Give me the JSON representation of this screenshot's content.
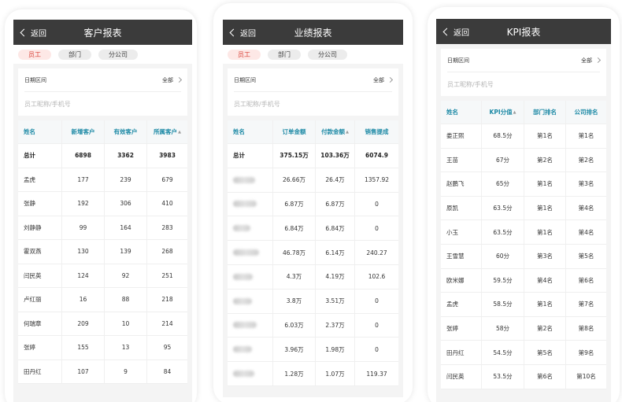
{
  "screens": [
    {
      "nav": {
        "back_label": "返回",
        "title": "客户报表"
      },
      "tabs": [
        {
          "label": "员工",
          "active": true
        },
        {
          "label": "部门"
        },
        {
          "label": "分公司"
        }
      ],
      "filter": {
        "date_label": "日期区间",
        "date_value": "全部",
        "search_placeholder": "员工昵称/手机号"
      },
      "table": {
        "headers": [
          "姓名",
          "新增客户",
          "有效客户",
          "所属客户"
        ],
        "total": [
          "总计",
          "6898",
          "3362",
          "3983"
        ],
        "rows": [
          [
            "孟虎",
            "177",
            "239",
            "679"
          ],
          [
            "张静",
            "192",
            "306",
            "410"
          ],
          [
            "刘静静",
            "99",
            "164",
            "283"
          ],
          [
            "霍双燕",
            "130",
            "139",
            "268"
          ],
          [
            "闫民英",
            "124",
            "92",
            "251"
          ],
          [
            "卢红丽",
            "16",
            "88",
            "218"
          ],
          [
            "何瑞章",
            "209",
            "10",
            "214"
          ],
          [
            "张婷",
            "155",
            "13",
            "95"
          ],
          [
            "田丹红",
            "107",
            "9",
            "84"
          ]
        ]
      }
    },
    {
      "nav": {
        "back_label": "返回",
        "title": "业绩报表"
      },
      "tabs": [
        {
          "label": "员工",
          "active": true
        },
        {
          "label": "部门"
        },
        {
          "label": "分公司"
        }
      ],
      "filter": {
        "date_label": "日期区间",
        "date_value": "全部",
        "search_placeholder": "员工昵称/手机号"
      },
      "table": {
        "headers": [
          "姓名",
          "订单金额",
          "付款金额",
          "销售提成"
        ],
        "total": [
          "总计",
          "375.15万",
          "103.36万",
          "6074.9"
        ],
        "rows": [
          [
            "",
            "26.66万",
            "26.4万",
            "1357.92"
          ],
          [
            "",
            "6.87万",
            "6.87万",
            "0"
          ],
          [
            "",
            "6.84万",
            "6.84万",
            "0"
          ],
          [
            "",
            "46.78万",
            "6.14万",
            "240.27"
          ],
          [
            "",
            "4.3万",
            "4.19万",
            "102.6"
          ],
          [
            "",
            "3.8万",
            "3.51万",
            "0"
          ],
          [
            "",
            "6.03万",
            "2.37万",
            "0"
          ],
          [
            "",
            "3.96万",
            "1.98万",
            "0"
          ],
          [
            "",
            "1.28万",
            "1.07万",
            "119.37"
          ]
        ]
      }
    },
    {
      "nav": {
        "back_label": "返回",
        "title": "KPI报表"
      },
      "filter": {
        "date_label": "日期区间",
        "date_value": "全部",
        "search_placeholder": "员工昵称/手机号"
      },
      "table": {
        "headers": [
          "姓名",
          "KPI分值",
          "部门排名",
          "公司排名"
        ],
        "rows": [
          [
            "娄正熙",
            "68.5分",
            "第1名",
            "第1名"
          ],
          [
            "王苗",
            "67分",
            "第2名",
            "第2名"
          ],
          [
            "赵鹏飞",
            "65分",
            "第1名",
            "第3名"
          ],
          [
            "原凯",
            "63.5分",
            "第1名",
            "第4名"
          ],
          [
            "小玉",
            "63.5分",
            "第1名",
            "第4名"
          ],
          [
            "王雪慧",
            "60分",
            "第3名",
            "第5名"
          ],
          [
            "欧米娜",
            "59.5分",
            "第4名",
            "第6名"
          ],
          [
            "孟虎",
            "58.5分",
            "第1名",
            "第7名"
          ],
          [
            "张婷",
            "58分",
            "第2名",
            "第8名"
          ],
          [
            "田丹红",
            "54.5分",
            "第5名",
            "第9名"
          ],
          [
            "闫民英",
            "53.5分",
            "第6名",
            "第10名"
          ]
        ]
      }
    }
  ],
  "colors": {
    "navbar": "#3b3b3b",
    "accent_red": "#d9433a",
    "header_teal": "#1e8aa6",
    "background": "#f4f4f4"
  }
}
